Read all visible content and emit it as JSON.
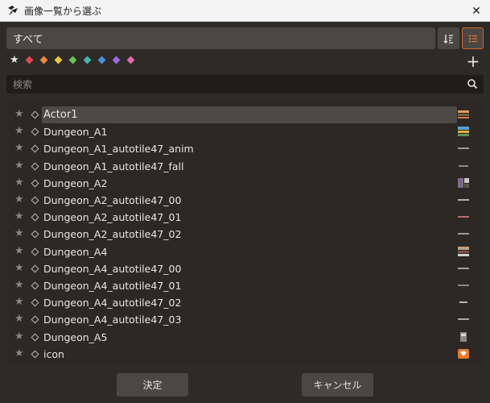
{
  "window": {
    "title": "画像一覧から選ぶ",
    "app_icon": "rpgmaker-icon",
    "close_glyph": "✕"
  },
  "toolbar": {
    "folder_value": "すべて",
    "sort_icon": "sort-icon",
    "view_icon": "list-view-icon",
    "add_glyph": "+"
  },
  "color_tags": {
    "star_glyph": "★",
    "colors": [
      "#e0474c",
      "#e98b3a",
      "#e6c63c",
      "#6fc056",
      "#3fb8a8",
      "#4b8fe0",
      "#9b6ae0",
      "#e06ab0"
    ]
  },
  "search": {
    "placeholder": "検索",
    "value": ""
  },
  "list": {
    "selected_index": 0,
    "items": [
      {
        "label": "Actor1"
      },
      {
        "label": "Dungeon_A1"
      },
      {
        "label": "Dungeon_A1_autotile47_anim"
      },
      {
        "label": "Dungeon_A1_autotile47_fall"
      },
      {
        "label": "Dungeon_A2"
      },
      {
        "label": "Dungeon_A2_autotile47_00"
      },
      {
        "label": "Dungeon_A2_autotile47_01"
      },
      {
        "label": "Dungeon_A2_autotile47_02"
      },
      {
        "label": "Dungeon_A4"
      },
      {
        "label": "Dungeon_A4_autotile47_00"
      },
      {
        "label": "Dungeon_A4_autotile47_01"
      },
      {
        "label": "Dungeon_A4_autotile47_02"
      },
      {
        "label": "Dungeon_A4_autotile47_03"
      },
      {
        "label": "Dungeon_A5"
      },
      {
        "label": "icon"
      }
    ]
  },
  "footer": {
    "ok_label": "決定",
    "cancel_label": "キャンセル"
  }
}
